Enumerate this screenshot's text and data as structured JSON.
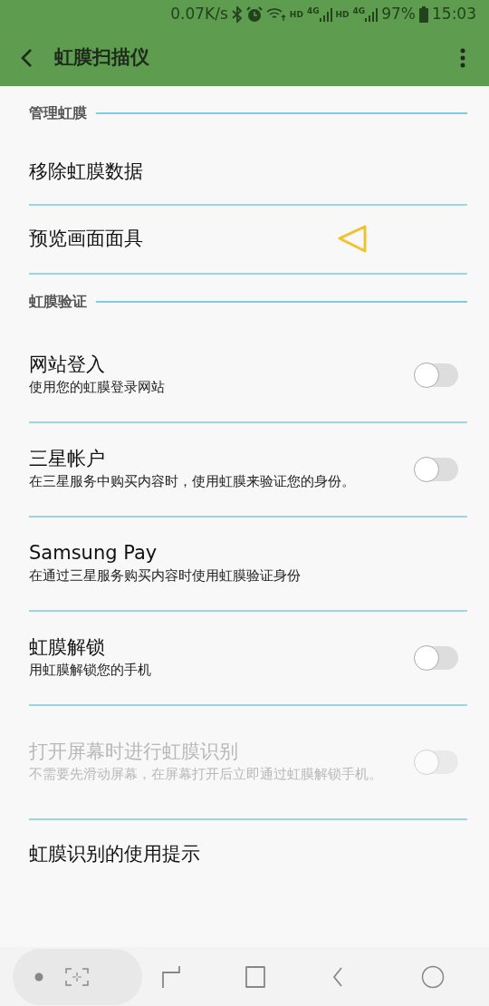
{
  "status_bar": {
    "speed": "0.07K/s",
    "battery": "97%",
    "time": "15:03",
    "hd_labels": [
      "HD",
      "HD"
    ],
    "network_labels": [
      "4G",
      "4G"
    ]
  },
  "app_bar": {
    "title": "虹膜扫描仪"
  },
  "sections": [
    {
      "header": "管理虹膜",
      "items": [
        {
          "kind": "link",
          "title": "移除虹膜数据"
        },
        {
          "kind": "link",
          "title": "预览画面面具",
          "pointer": true
        }
      ]
    },
    {
      "header": "虹膜验证",
      "items": [
        {
          "kind": "toggle",
          "title": "网站登入",
          "subtitle": "使用您的虹膜登录网站",
          "on": false,
          "disabled": false
        },
        {
          "kind": "toggle",
          "title": "三星帐户",
          "subtitle": "在三星服务中购买内容时，使用虹膜来验证您的身份。",
          "on": false,
          "disabled": false
        },
        {
          "kind": "link",
          "title": "Samsung Pay",
          "subtitle": "在通过三星服务购买内容时使用虹膜验证身份"
        },
        {
          "kind": "toggle",
          "title": "虹膜解锁",
          "subtitle": "用虹膜解锁您的手机",
          "on": false,
          "disabled": false
        },
        {
          "kind": "toggle",
          "title": "打开屏幕时进行虹膜识别",
          "subtitle": "不需要先滑动屏幕，在屏幕打开后立即通过虹膜解锁手机。",
          "on": false,
          "disabled": true
        },
        {
          "kind": "link",
          "title": "虹膜识别的使用提示"
        }
      ]
    }
  ]
}
